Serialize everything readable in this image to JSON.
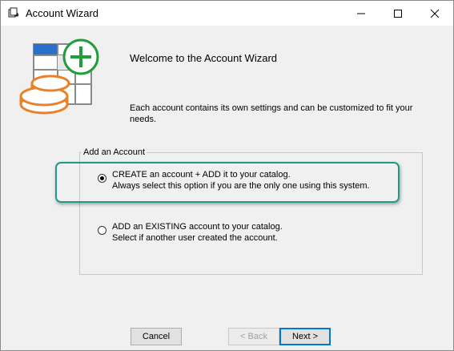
{
  "window": {
    "title": "Account Wizard",
    "app_icon": "wizard-app-icon",
    "controls": {
      "minimize_icon": "minimize-icon",
      "maximize_icon": "maximize-icon",
      "close_icon": "close-icon"
    }
  },
  "header": {
    "art_icon": "account-plus-coins-icon",
    "welcome_title": "Welcome to the Account Wizard",
    "intro_text": "Each account contains its own settings and can be customized to fit your needs."
  },
  "add_account_group": {
    "label": "Add an Account",
    "options": [
      {
        "line1": "CREATE an account + ADD it to your catalog.",
        "line2": "Always select this option if you are the only one using this system.",
        "selected": true
      },
      {
        "line1": "ADD an EXISTING account to your catalog.",
        "line2": "Select if another user created the account.",
        "selected": false
      }
    ]
  },
  "buttons": {
    "cancel": "Cancel",
    "back": "< Back",
    "next": "Next >",
    "back_enabled": false
  },
  "colors": {
    "highlight": "#1e9a86",
    "plus_green": "#1f9e3a",
    "coins_orange": "#e8822a",
    "table_blue": "#2a6fc9"
  }
}
